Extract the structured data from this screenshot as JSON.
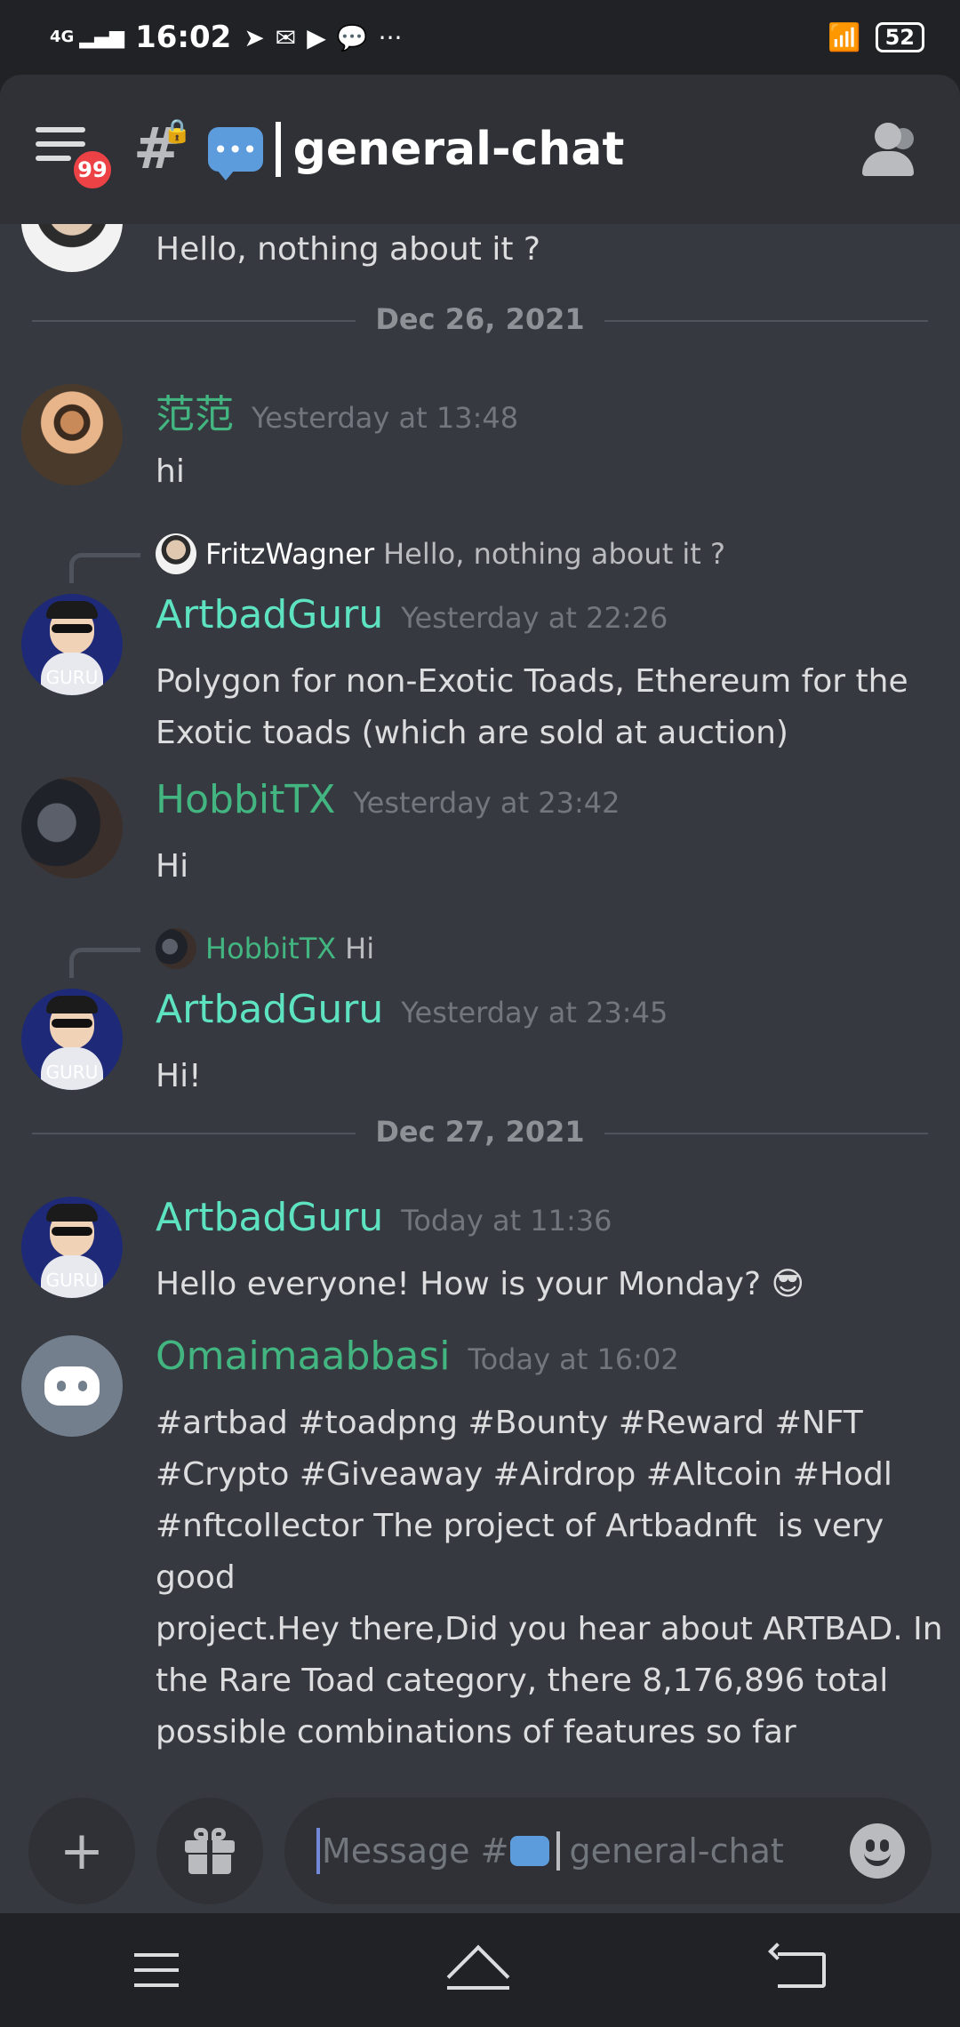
{
  "status_bar": {
    "signal": "4G",
    "time": "16:02",
    "notification_icons": [
      "telegram-icon",
      "mail-icon",
      "youtube-icon",
      "chat-bubble-icon",
      "more-icon"
    ],
    "battery": "52"
  },
  "header": {
    "notification_badge": "99",
    "channel_title": "general-chat",
    "channel_emoji": "💬"
  },
  "messages": [
    {
      "text": "Hello, nothing about it ?"
    },
    {
      "divider": "Dec 26, 2021"
    },
    {
      "author": "范范",
      "timestamp": "Yesterday at 13:48",
      "text": "hi",
      "name_color": "#43b581"
    },
    {
      "reply_author": "FritzWagner",
      "reply_text": "Hello, nothing about it ?",
      "author": "ArtbadGuru",
      "timestamp": "Yesterday at 22:26",
      "text": "Polygon for non-Exotic Toads, Ethereum for the\nExotic toads (which are sold at auction)",
      "name_color": "#5ee3c1"
    },
    {
      "author": "HobbitTX",
      "timestamp": "Yesterday at 23:42",
      "text": "Hi",
      "name_color": "#43b581"
    },
    {
      "reply_author": "HobbitTX",
      "reply_text": "Hi",
      "author": "ArtbadGuru",
      "timestamp": "Yesterday at 23:45",
      "text": "Hi!",
      "name_color": "#5ee3c1"
    },
    {
      "divider": "Dec 27, 2021"
    },
    {
      "author": "ArtbadGuru",
      "timestamp": "Today at 11:36",
      "text": "Hello everyone! How is your Monday? 😎",
      "name_color": "#5ee3c1"
    },
    {
      "author": "Omaimaabbasi",
      "timestamp": "Today at 16:02",
      "text": "#artbad #toadpng #Bounty #Reward #NFT\n#Crypto #Giveaway #Airdrop #Altcoin #Hodl\n#nftcollector The project of Artbadnft  is very good\nproject.Hey there,Did you hear about ARTBAD. In\nthe Rare Toad category, there 8,176,896 total\npossible combinations of features so far",
      "name_color": "#43b581"
    }
  ],
  "avatar_label": "GURU",
  "composer": {
    "placeholder_prefix": "Message #",
    "placeholder_channel": "general-chat"
  }
}
